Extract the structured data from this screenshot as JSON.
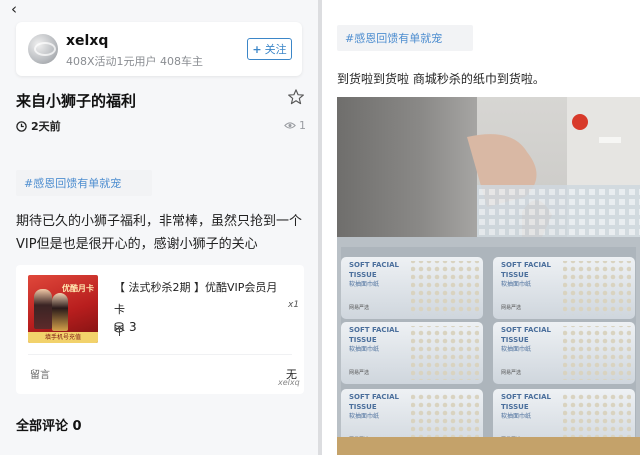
{
  "left": {
    "back_icon": "back-arrow-icon",
    "user": {
      "name": "xelxq",
      "meta": "408X活动1元用户  408车主",
      "follow_label": "关注"
    },
    "post": {
      "title": "来自小狮子的福利",
      "time": "2天前",
      "views": "1",
      "tag": "#感恩回馈有单就宠",
      "body": "期待已久的小狮子福利，非常棒，虽然只抢到一个VIP但是也是很开心的，感谢小狮子的关心"
    },
    "product": {
      "title": "【 法式秒杀2期 】优酷VIP会员月卡",
      "title_suffix": "个",
      "x_mark": "x1",
      "coins": "3",
      "comment_label": "留言",
      "comment_value": "无",
      "sign": "xelxq",
      "image_badge": "优酷月卡",
      "image_footer": "填手机号充值"
    },
    "comments": {
      "label": "全部评论",
      "count": "0"
    }
  },
  "right": {
    "tag": "#感恩回馈有单就宠",
    "text": "到货啦到货啦  商城秒杀的纸巾到货啦。",
    "photo": {
      "packages": [
        {
          "line1": "SOFT FACIAL",
          "line2": "TISSUE",
          "line3": "软抽面巾纸",
          "brand": "网易严选"
        },
        {
          "line1": "SOFT FACIAL",
          "line2": "TISSUE",
          "line3": "软抽面巾纸",
          "brand": "网易严选"
        },
        {
          "line1": "SOFT FACIAL",
          "line2": "TISSUE",
          "line3": "软抽面巾纸",
          "brand": "网易严选"
        },
        {
          "line1": "SOFT FACIAL",
          "line2": "TISSUE",
          "line3": "软抽面巾纸",
          "brand": "网易严选"
        },
        {
          "line1": "SOFT FACIAL",
          "line2": "TISSUE",
          "line3": "软抽面巾纸",
          "brand": "网易严选"
        },
        {
          "line1": "SOFT FACIAL",
          "line2": "TISSUE",
          "line3": "软抽面巾纸",
          "brand": "网易严选"
        }
      ]
    }
  },
  "colors": {
    "accent": "#3b86c8",
    "tag_text": "#4e8ed0",
    "tag_bg": "#f2f3f5"
  }
}
